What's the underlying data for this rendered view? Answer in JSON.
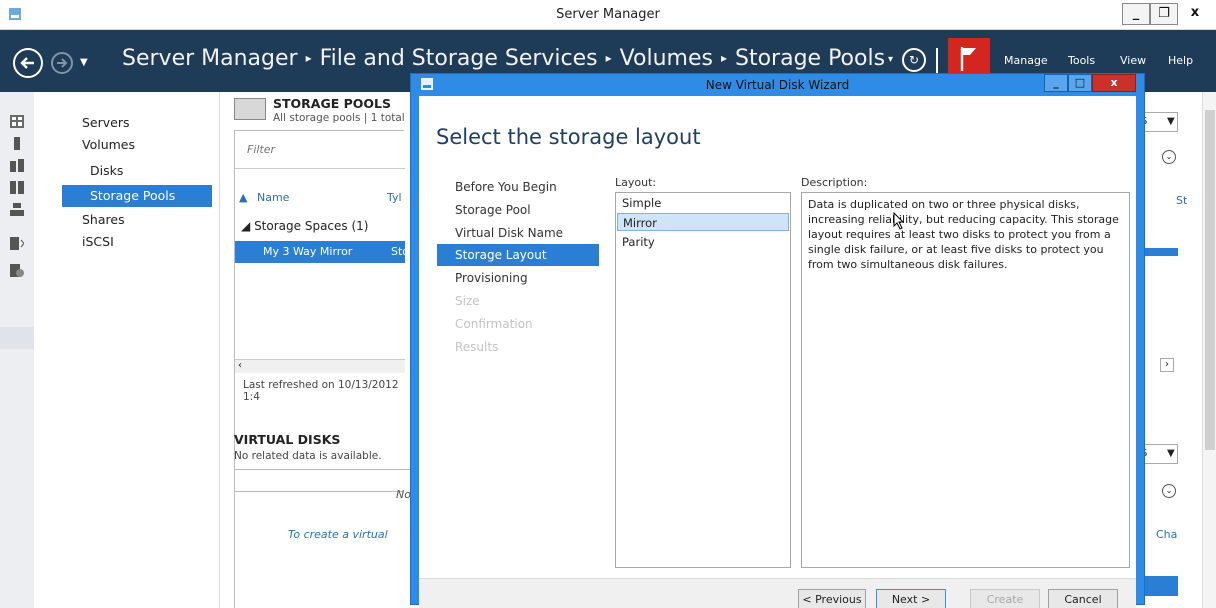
{
  "window": {
    "title": "Server Manager",
    "min_glyph": "_",
    "max_glyph": "❐",
    "close_glyph": "x"
  },
  "header": {
    "breadcrumb": [
      "Server Manager",
      "File and Storage Services",
      "Volumes",
      "Storage Pools"
    ],
    "menu": [
      "Manage",
      "Tools",
      "View",
      "Help"
    ]
  },
  "nav": {
    "items": [
      {
        "label": "Servers"
      },
      {
        "label": "Volumes"
      },
      {
        "label": "Disks"
      },
      {
        "label": "Storage Pools"
      },
      {
        "label": "Shares"
      },
      {
        "label": "iSCSI"
      }
    ]
  },
  "pools": {
    "title": "STORAGE POOLS",
    "subtitle": "All storage pools | 1 total",
    "filter_placeholder": "Filter",
    "col_name": "Name",
    "col_type_partial": "Tyl",
    "group": "Storage Spaces (1)",
    "row_name": "My 3 Way Mirror",
    "row_type_partial": "Sto",
    "refreshed": "Last refreshed on 10/13/2012 1:4"
  },
  "virtual_disks": {
    "title": "VIRTUAL DISKS",
    "subtitle": "No related data is available.",
    "empty_partial": "No",
    "create_partial": "To create a virtual"
  },
  "right_remnants": {
    "tasks_partial_1": "S",
    "status_partial": "St",
    "tasks_partial_2": "S",
    "changes_partial": "Cha"
  },
  "wizard": {
    "title": "New Virtual Disk Wizard",
    "heading": "Select the storage layout",
    "steps": [
      {
        "label": "Before You Begin",
        "state": "done"
      },
      {
        "label": "Storage Pool",
        "state": "done"
      },
      {
        "label": "Virtual Disk Name",
        "state": "done"
      },
      {
        "label": "Storage Layout",
        "state": "current"
      },
      {
        "label": "Provisioning",
        "state": "pending"
      },
      {
        "label": "Size",
        "state": "disabled"
      },
      {
        "label": "Confirmation",
        "state": "disabled"
      },
      {
        "label": "Results",
        "state": "disabled"
      }
    ],
    "layout_label": "Layout:",
    "layouts": [
      "Simple",
      "Mirror",
      "Parity"
    ],
    "selected_layout": "Mirror",
    "description_label": "Description:",
    "description": "Data is duplicated on two or three physical disks, increasing reliability, but reducing capacity. This storage layout requires at least two disks to protect you from a single disk failure, or at least five disks to protect you from two simultaneous disk failures.",
    "buttons": {
      "previous": "< Previous",
      "next": "Next >",
      "create": "Create",
      "cancel": "Cancel"
    }
  },
  "colors": {
    "header_bg": "#1e3b58",
    "accent": "#2a7fd4",
    "wizard_frame": "#2e8ce6",
    "flag_red": "#d2261f"
  }
}
